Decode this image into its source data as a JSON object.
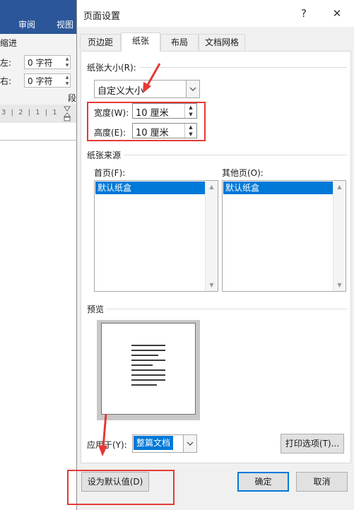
{
  "word": {
    "tab_review": "审阅",
    "tab_view": "视图",
    "indent_heading": "缩进",
    "indent_left_label": "左:",
    "indent_left_value": "0 字符",
    "indent_right_label": "右:",
    "indent_right_value": "0 字符",
    "paragraph_group": "段",
    "ruler_marks": "3 | 2 | 1 | 1"
  },
  "dialog": {
    "title": "页面设置",
    "help_label": "?",
    "close_label": "✕",
    "tabs": [
      {
        "label": "页边距",
        "active": false
      },
      {
        "label": "纸张",
        "active": true
      },
      {
        "label": "布局",
        "active": false
      },
      {
        "label": "文档网格",
        "active": false
      }
    ],
    "paper_size": {
      "section_label": "纸张大小(R):",
      "selected": "自定义大小"
    },
    "width": {
      "label": "宽度(W):",
      "value": "10 厘米"
    },
    "height": {
      "label": "高度(E):",
      "value": "10 厘米"
    },
    "paper_source": {
      "section_label": "纸张来源",
      "first_page_label": "首页(F):",
      "first_page_selected": "默认纸盒",
      "other_pages_label": "其他页(O):",
      "other_pages_selected": "默认纸盒"
    },
    "preview": {
      "section_label": "预览"
    },
    "apply_to": {
      "label": "应用于(Y):",
      "selected": "整篇文档"
    },
    "print_options_label": "打印选项(T)...",
    "set_default_label": "设为默认值(D)",
    "ok_label": "确定",
    "cancel_label": "取消"
  },
  "colors": {
    "accent": "#0078d7",
    "annotation_red": "#e53935",
    "word_blue": "#2b579a"
  }
}
